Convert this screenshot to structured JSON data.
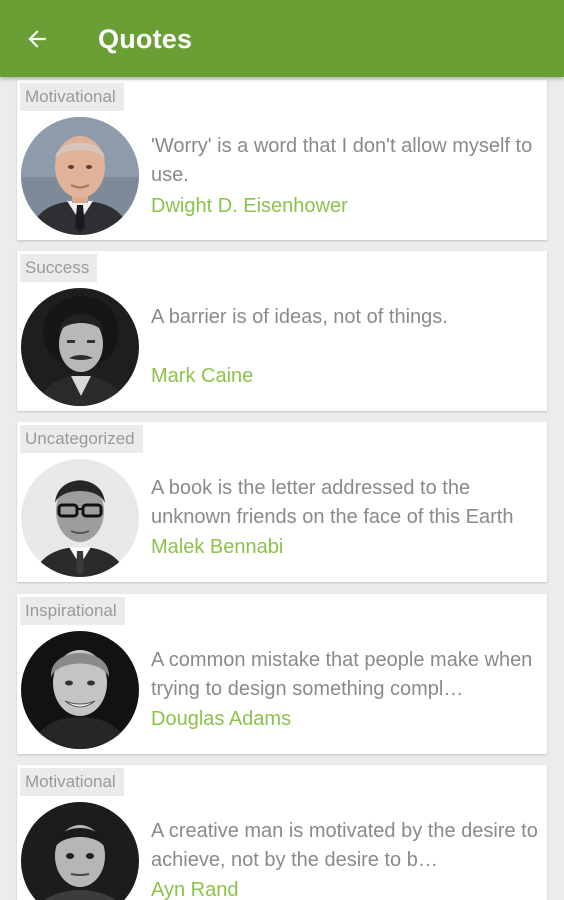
{
  "appbar": {
    "title": "Quotes",
    "back_icon": "arrow-left-icon",
    "color": "#6a9f36"
  },
  "colors": {
    "author": "#8bc34a",
    "quote_text": "#8a8a8a",
    "category_text": "#9a9a9a",
    "category_bg": "#ebebeb"
  },
  "quotes": [
    {
      "category": "Motivational",
      "text": "'Worry' is a word that I don't allow myself to use.",
      "author": "Dwight D. Eisenhower",
      "avatar": "portrait-photo"
    },
    {
      "category": "Success",
      "text": "A barrier is of ideas, not of things.",
      "author": "Mark Caine",
      "avatar": "portrait-photo"
    },
    {
      "category": "Uncategorized",
      "text": "A book is the letter addressed to the unknown friends on the face of this Earth",
      "author": "Malek Bennabi",
      "avatar": "portrait-photo"
    },
    {
      "category": "Inspirational",
      "text": "A common mistake that people make when trying to design something compl…",
      "author": "Douglas Adams",
      "avatar": "portrait-photo"
    },
    {
      "category": "Motivational",
      "text": "A creative man is motivated by the desire to achieve, not by the desire to b…",
      "author": "Ayn Rand",
      "avatar": "portrait-photo"
    }
  ]
}
